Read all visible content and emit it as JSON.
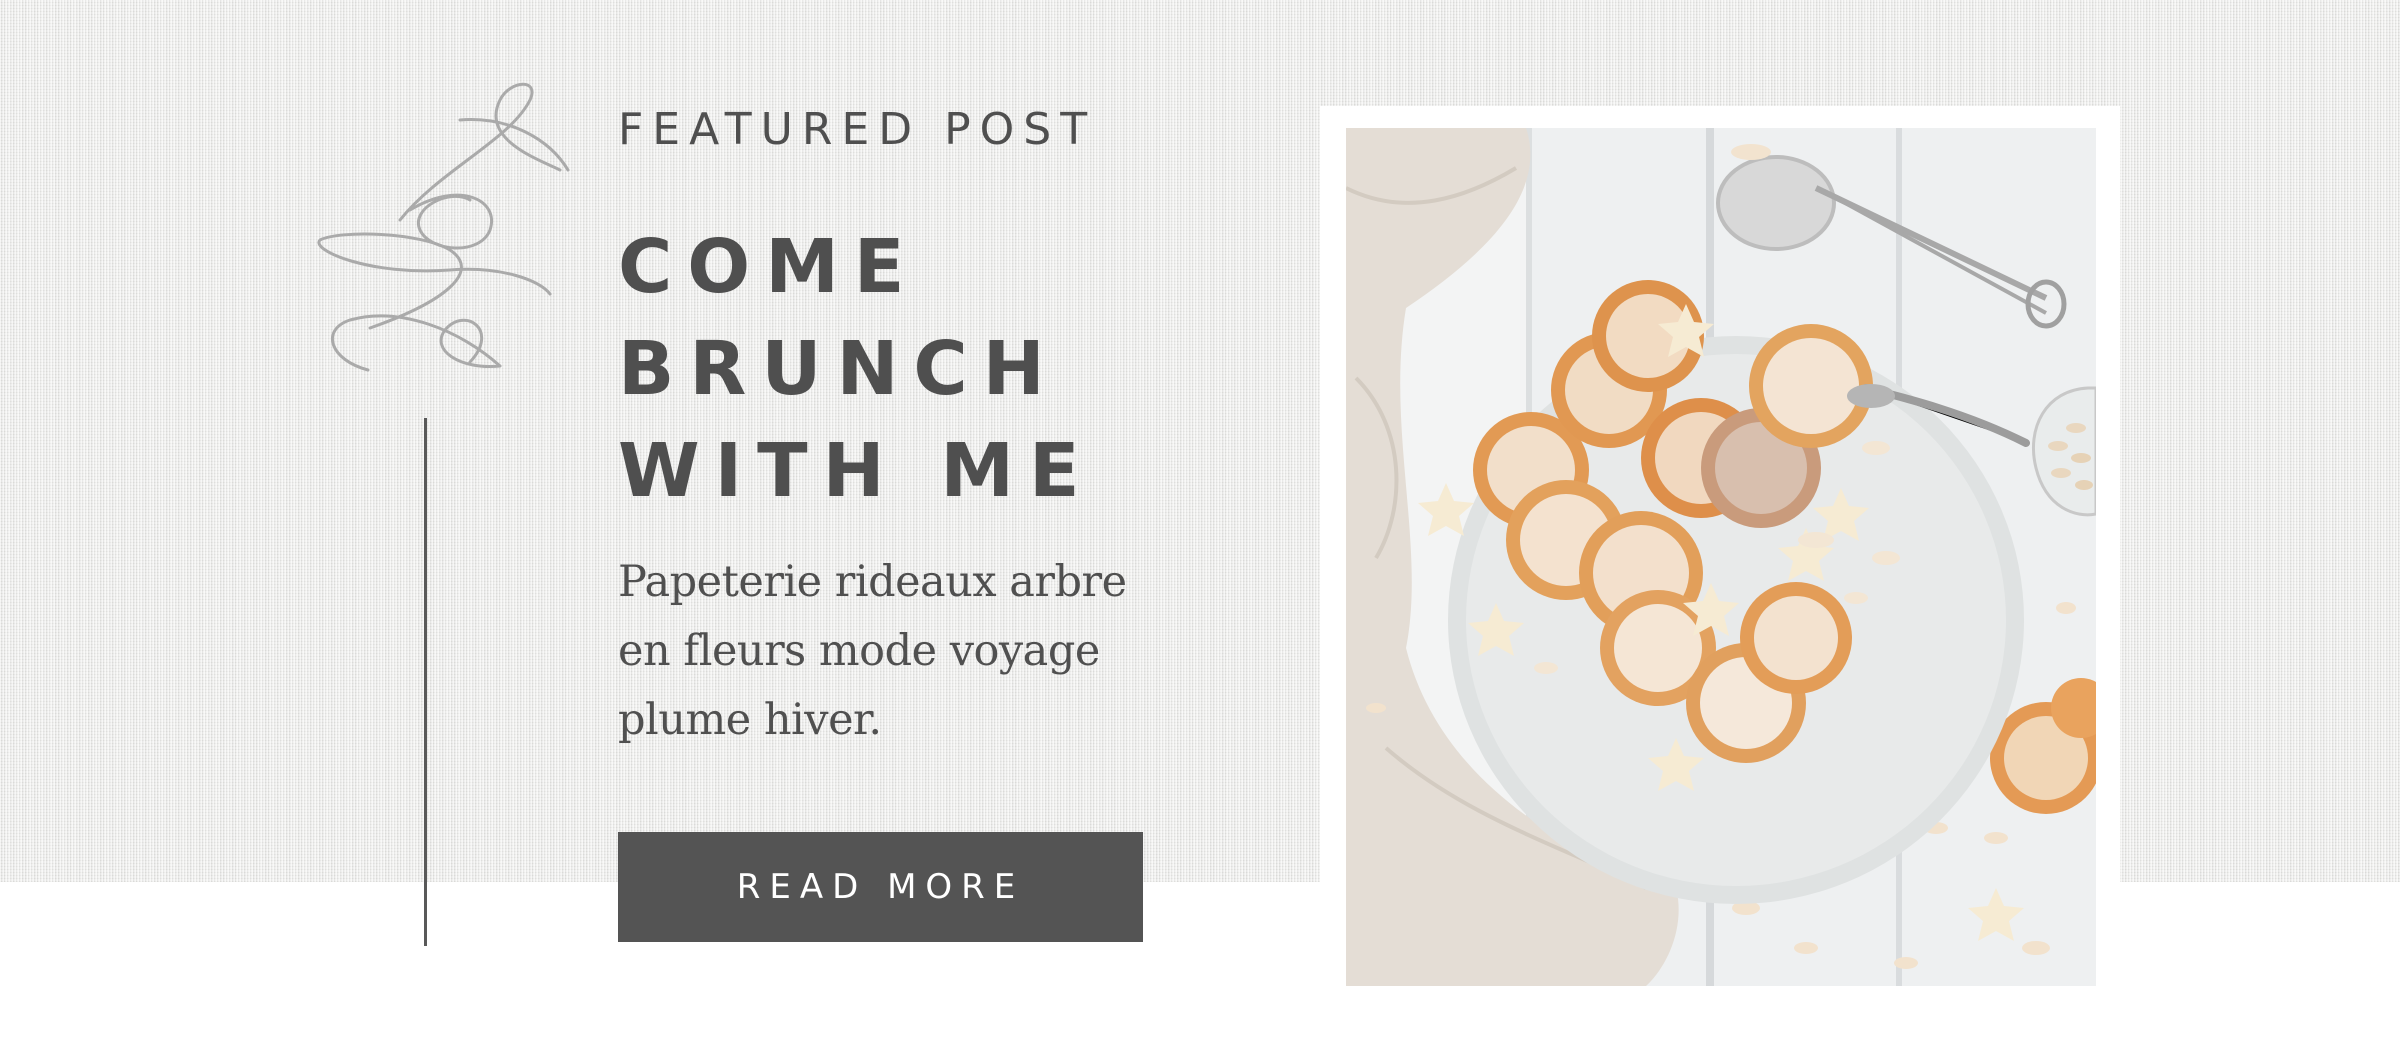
{
  "featured": {
    "eyebrow": "FEATURED POST",
    "headline_lines": [
      "COME",
      "BRUNCH",
      "WITH ME"
    ],
    "excerpt": "Papeterie rideaux arbre en fleurs mode voyage plume hiver.",
    "button_label": "READ MORE"
  },
  "decor": {
    "script_word": "blog"
  },
  "colors": {
    "text_dark": "#4f4f4f",
    "button_bg": "#545454",
    "button_text": "#ffffff",
    "script_gray": "#aaaaaa",
    "background_linen": "#ececea"
  },
  "image": {
    "subject": "plate of pancakes with sugar stars and almonds"
  }
}
